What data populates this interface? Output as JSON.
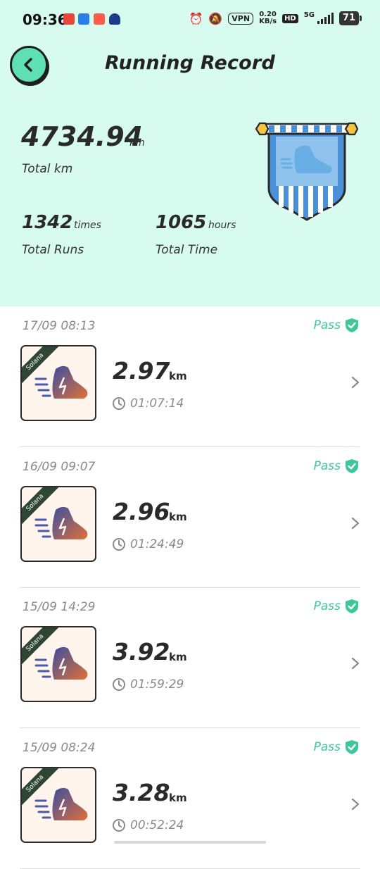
{
  "status_bar": {
    "time": "09:36",
    "vpn": "VPN",
    "net_speed_value": "0.20",
    "net_speed_unit": "KB/s",
    "hd": "HD",
    "network": "5G",
    "battery": "71"
  },
  "header": {
    "title": "Running Record"
  },
  "summary": {
    "total_km_value": "4734.94",
    "total_km_unit": "km",
    "total_km_label": "Total km",
    "total_runs_value": "1342",
    "total_runs_unit": "times",
    "total_runs_label": "Total Runs",
    "total_time_value": "1065",
    "total_time_unit": "hours",
    "total_time_label": "Total Time"
  },
  "colors": {
    "header_bg": "#d7fbef",
    "accent_green": "#3ec79a",
    "back_button": "#5ee0b4",
    "flag_blue": "#4a90d9"
  },
  "records": [
    {
      "date": "17/09 08:13",
      "status": "Pass",
      "badge": "Solana",
      "distance": "2.97",
      "unit": "km",
      "duration": "01:07:14"
    },
    {
      "date": "16/09 09:07",
      "status": "Pass",
      "badge": "Solana",
      "distance": "2.96",
      "unit": "km",
      "duration": "01:24:49"
    },
    {
      "date": "15/09 14:29",
      "status": "Pass",
      "badge": "Solana",
      "distance": "3.92",
      "unit": "km",
      "duration": "01:59:29"
    },
    {
      "date": "15/09 08:24",
      "status": "Pass",
      "badge": "Solana",
      "distance": "3.28",
      "unit": "km",
      "duration": "00:52:24"
    }
  ]
}
